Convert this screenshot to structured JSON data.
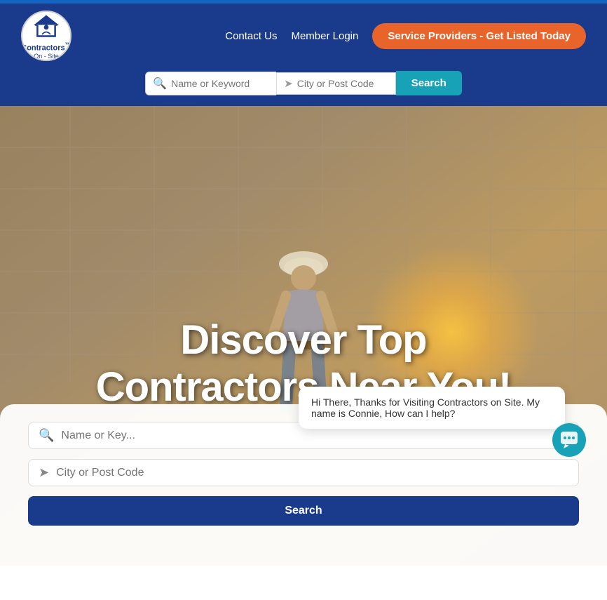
{
  "topbar": {},
  "header": {
    "logo_text": "Contractors",
    "logo_superscript": "™",
    "logo_sub": "On - Site",
    "nav": {
      "contact_label": "Contact Us",
      "login_label": "Member Login",
      "cta_label": "Service Providers - Get Listed Today"
    },
    "search": {
      "keyword_placeholder": "Name or Keyword",
      "location_placeholder": "City or Post Code",
      "search_label": "Search"
    }
  },
  "hero": {
    "title_line1": "Discover Top",
    "title_line2": "Contractors Near You!"
  },
  "bottom_search": {
    "keyword_placeholder": "Name or Key...",
    "location_placeholder": "City or Post Code",
    "search_label": "Search"
  },
  "chat": {
    "message": "Hi There, Thanks for Visiting Contractors on Site. My name is Connie, How can I help?"
  },
  "colors": {
    "header_bg": "#1a3a8c",
    "cta_bg": "#e8642a",
    "search_btn_bg": "#17a2b8",
    "topbar_bg": "#1565c0"
  }
}
